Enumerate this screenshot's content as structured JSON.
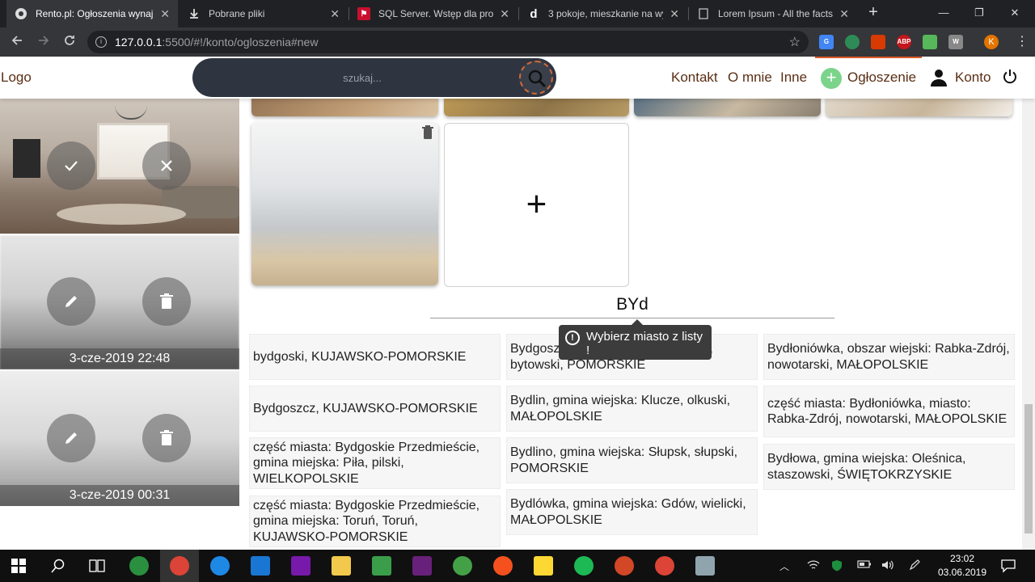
{
  "browser": {
    "tabs": [
      {
        "title": "Rento.pl: Ogłoszenia wynajmu",
        "fav_text": ""
      },
      {
        "title": "Pobrane pliki",
        "fav_text": ""
      },
      {
        "title": "SQL Server. Wstęp dla prog",
        "fav_text": ""
      },
      {
        "title": "3 pokoje, mieszkanie na wy",
        "fav_text": "d"
      },
      {
        "title": "Lorem Ipsum - All the facts",
        "fav_text": ""
      }
    ],
    "tab_close": "✕",
    "new_tab": "+",
    "window_controls": {
      "minimize": "—",
      "maximize": "❐",
      "close": "✕"
    },
    "url_host": "127.0.0.1",
    "url_rest": ":5500/#!/konto/ogloszenia#new",
    "star": "☆",
    "profile_initial": "K",
    "extensions": [
      "G",
      "",
      "",
      "ABP",
      "",
      "W"
    ]
  },
  "header": {
    "logo": "Logo",
    "search_placeholder": "szukaj...",
    "nav": {
      "contact": "Kontakt",
      "about": "O mnie",
      "other": "Inne",
      "listing": "Ogłoszenie",
      "account": "Konto"
    },
    "plus": "+"
  },
  "sidebar": {
    "cards": [
      {
        "date": ""
      },
      {
        "date": "3-cze-2019 22:48"
      },
      {
        "date": "3-cze-2019 00:31"
      }
    ]
  },
  "main": {
    "add_label": "+",
    "city_input": "BYd",
    "tooltip": "Wybierz miasto z listy !",
    "tooltip_icon": "!",
    "results_col1": [
      "bydgoski, KUJAWSKO-POMORSKIE",
      "Bydgoszcz, KUJAWSKO-POMORSKIE",
      "część miasta: Bydgoskie Przedmieście, gmina miejska: Piła, pilski, WIELKOPOLSKIE",
      "część miasta: Bydgoskie Przedmieście, gmina miejska: Toruń, Toruń, KUJAWSKO-POMORSKIE"
    ],
    "results_col2": [
      "Bydgoszcz, gmina wiejska: Lipnica, bytowski, POMORSKIE",
      "Bydlin, gmina wiejska: Klucze, olkuski, MAŁOPOLSKIE",
      "Bydlino, gmina wiejska: Słupsk, słupski, POMORSKIE",
      "Bydlówka, gmina wiejska: Gdów, wielicki, MAŁOPOLSKIE"
    ],
    "results_col3": [
      "Bydłoniówka, obszar wiejski: Rabka-Zdrój, nowotarski, MAŁOPOLSKIE",
      "część miasta: Bydłoniówka, miasto: Rabka-Zdrój, nowotarski, MAŁOPOLSKIE",
      "Bydłowa, gmina wiejska: Oleśnica, staszowski, ŚWIĘTOKRZYSKIE"
    ]
  },
  "taskbar": {
    "time": "23:02",
    "date": "03.06.2019"
  },
  "colors": {
    "accent": "#e05a2a",
    "brown_text": "#5a2e14",
    "search_bg": "#2e3440",
    "plus_green": "#7bd48a"
  }
}
